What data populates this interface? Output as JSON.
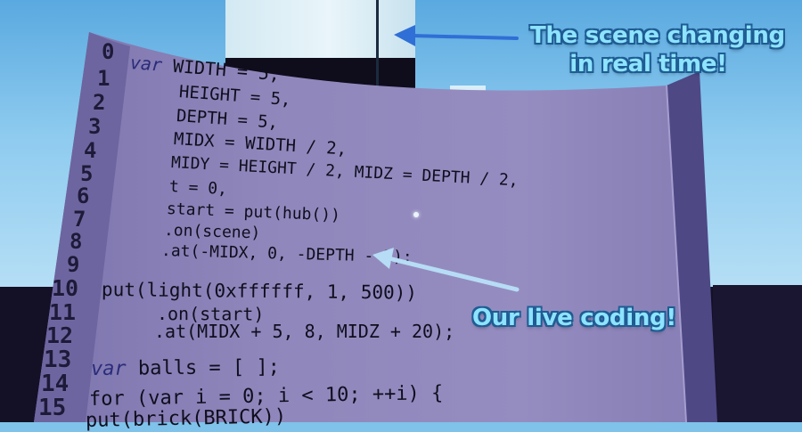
{
  "colors": {
    "panel_face": "#8a82b6",
    "panel_gutter": "#6f67a1",
    "panel_edge": "#4d4782",
    "code_text": "#0f0e1e",
    "keyword": "#2a2c7a",
    "annotation_fill": "#8ee3ff",
    "annotation_outline": "#1e5c93",
    "arrow_blue": "#2f6fd6",
    "arrow_light": "#b7dcf5"
  },
  "annotations": {
    "scene_line1": "The scene changing",
    "scene_line2": "in real time!",
    "live": "Our live coding!"
  },
  "editor": {
    "line_numbers": [
      "0",
      "1",
      "2",
      "3",
      "4",
      "5",
      "6",
      "7",
      "8",
      "9",
      "10",
      "11",
      "12",
      "13",
      "14",
      "15"
    ],
    "lines": [
      {
        "kw": "var",
        "text": " WIDTH = 5,"
      },
      {
        "kw": "",
        "text": "HEIGHT = 5,"
      },
      {
        "kw": "",
        "text": "DEPTH = 5,"
      },
      {
        "kw": "",
        "text": "MIDX = WIDTH / 2,"
      },
      {
        "kw": "",
        "text": "MIDY = HEIGHT / 2, MIDZ = DEPTH / 2,"
      },
      {
        "kw": "",
        "text": "t = 0,"
      },
      {
        "kw": "",
        "text": "start = put(hub())"
      },
      {
        "kw": "",
        "text": ".on(scene)"
      },
      {
        "kw": "",
        "text": ".at(-MIDX, 0, -DEPTH - 2);"
      },
      {
        "kw": "",
        "text": ""
      },
      {
        "kw": "",
        "text": "put(light(0xffffff, 1, 500))"
      },
      {
        "kw": "",
        "text": ".on(start)"
      },
      {
        "kw": "",
        "text": ".at(MIDX + 5, 8, MIDZ + 20);"
      },
      {
        "kw": "",
        "text": ""
      },
      {
        "kw": "var",
        "text": " balls = [ ];"
      },
      {
        "kw": "",
        "text": ""
      },
      {
        "kw": "",
        "text": "for (var i = 0; i < 10; ++i) {"
      },
      {
        "kw": "",
        "text": "put(brick(BRICK))"
      }
    ]
  }
}
